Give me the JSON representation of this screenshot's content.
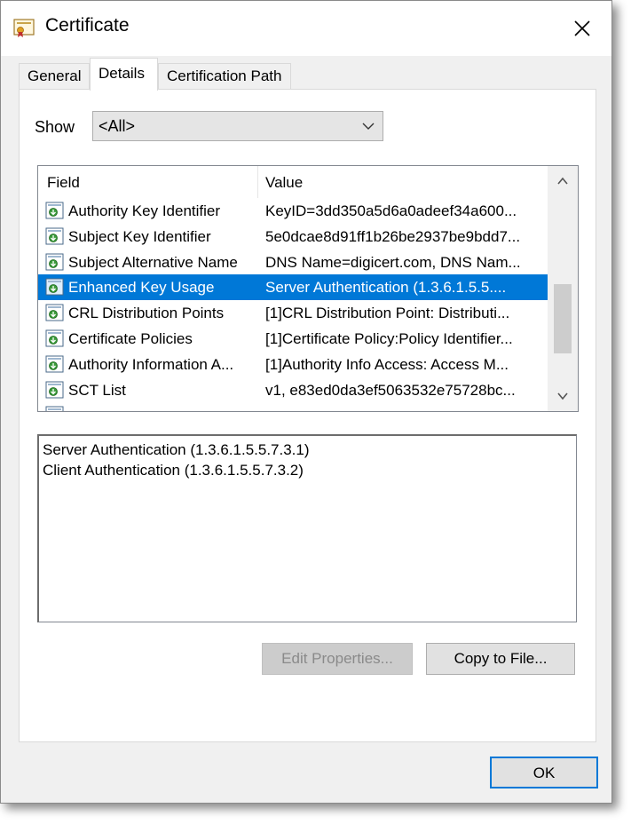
{
  "window": {
    "title": "Certificate",
    "icons": {
      "title": "certificate-icon",
      "close": "close-icon"
    }
  },
  "tabs": [
    {
      "label": "General",
      "active": false
    },
    {
      "label": "Details",
      "active": true
    },
    {
      "label": "Certification Path",
      "active": false
    }
  ],
  "details": {
    "show_label": "Show",
    "show_value": "<All>",
    "columns": {
      "field": "Field",
      "value": "Value"
    },
    "rows": [
      {
        "field": "Authority Key Identifier",
        "value": "KeyID=3dd350a5d6a0adeef34a600..."
      },
      {
        "field": "Subject Key Identifier",
        "value": "5e0dcae8d91ff1b26be2937be9bdd7..."
      },
      {
        "field": "Subject Alternative Name",
        "value": "DNS Name=digicert.com, DNS Nam..."
      },
      {
        "field": "Enhanced Key Usage",
        "value": "Server Authentication (1.3.6.1.5.5....",
        "selected": true
      },
      {
        "field": "CRL Distribution Points",
        "value": "[1]CRL Distribution Point: Distributi..."
      },
      {
        "field": "Certificate Policies",
        "value": "[1]Certificate Policy:Policy Identifier..."
      },
      {
        "field": "Authority Information A...",
        "value": "[1]Authority Info Access: Access M..."
      },
      {
        "field": "SCT List",
        "value": "v1, e83ed0da3ef5063532e75728bc..."
      }
    ],
    "detail_lines": [
      "Server Authentication (1.3.6.1.5.5.7.3.1)",
      "Client Authentication (1.3.6.1.5.5.7.3.2)"
    ]
  },
  "buttons": {
    "edit_properties": "Edit Properties...",
    "copy_to_file": "Copy to File...",
    "ok": "OK"
  },
  "colors": {
    "selection": "#0078d7",
    "window_bg": "#f0f0f0"
  }
}
